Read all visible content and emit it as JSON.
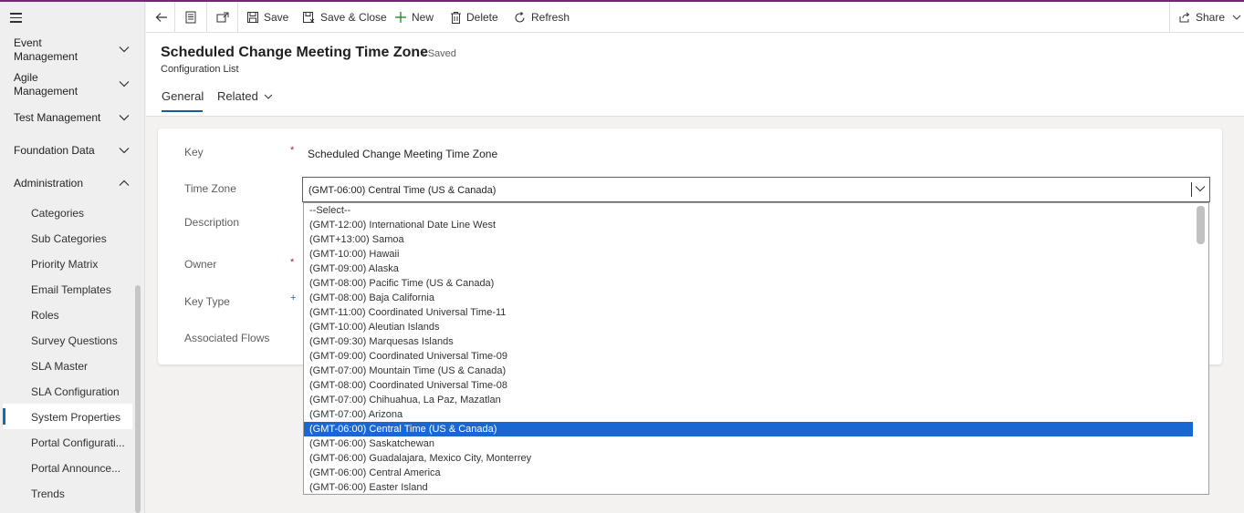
{
  "sidebar": {
    "groups": [
      {
        "label": "Event Management"
      },
      {
        "label": "Agile Management"
      },
      {
        "label": "Test Management"
      },
      {
        "label": "Foundation Data"
      },
      {
        "label": "Administration"
      }
    ],
    "items": [
      {
        "label": "Categories"
      },
      {
        "label": "Sub Categories"
      },
      {
        "label": "Priority Matrix"
      },
      {
        "label": "Email Templates"
      },
      {
        "label": "Roles"
      },
      {
        "label": "Survey Questions"
      },
      {
        "label": "SLA Master"
      },
      {
        "label": "SLA Configuration"
      },
      {
        "label": "System Properties"
      },
      {
        "label": "Portal Configurati..."
      },
      {
        "label": "Portal Announce..."
      },
      {
        "label": "Trends"
      }
    ],
    "active_item": "System Properties"
  },
  "toolbar": {
    "save": "Save",
    "save_close": "Save & Close",
    "new": "New",
    "delete": "Delete",
    "refresh": "Refresh",
    "share": "Share"
  },
  "record": {
    "title": "Scheduled Change Meeting Time Zone",
    "status": "- Saved",
    "entity": "Configuration List"
  },
  "tabs": [
    {
      "label": "General"
    },
    {
      "label": "Related"
    }
  ],
  "form": {
    "key_label": "Key",
    "key_value": "Scheduled Change Meeting Time Zone",
    "timezone_label": "Time Zone",
    "timezone_value": "(GMT-06:00) Central Time (US & Canada)",
    "description_label": "Description",
    "owner_label": "Owner",
    "keytype_label": "Key Type",
    "flows_label": "Associated Flows",
    "required_mark": "*",
    "recommended_mark": "+"
  },
  "dropdown_options": [
    "--Select--",
    "(GMT-12:00) International Date Line West",
    "(GMT+13:00) Samoa",
    "(GMT-10:00) Hawaii",
    "(GMT-09:00) Alaska",
    "(GMT-08:00) Pacific Time (US & Canada)",
    "(GMT-08:00) Baja California",
    "(GMT-11:00) Coordinated Universal Time-11",
    "(GMT-10:00) Aleutian Islands",
    "(GMT-09:30) Marquesas Islands",
    "(GMT-09:00) Coordinated Universal Time-09",
    "(GMT-07:00) Mountain Time (US & Canada)",
    "(GMT-08:00) Coordinated Universal Time-08",
    "(GMT-07:00) Chihuahua, La Paz, Mazatlan",
    "(GMT-07:00) Arizona",
    "(GMT-06:00) Central Time (US & Canada)",
    "(GMT-06:00) Saskatchewan",
    "(GMT-06:00) Guadalajara, Mexico City, Monterrey",
    "(GMT-06:00) Central America",
    "(GMT-06:00) Easter Island"
  ],
  "selected_option": "(GMT-06:00) Central Time (US & Canada)",
  "colors": {
    "accent": "#742774",
    "selection": "#1967d2",
    "tab_underline": "#115ea3",
    "required": "#a4262c"
  }
}
